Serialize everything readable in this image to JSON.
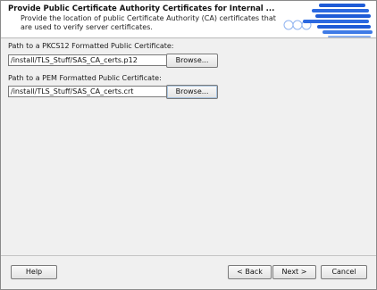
{
  "header": {
    "title": "Provide Public Certificate Authority Certificates for Internal ...",
    "description": "Provide the location of public Certificate Authority (CA) certificates that are used to verify server certificates."
  },
  "pkcs12": {
    "label": "Path to a PKCS12 Formatted Public Certificate:",
    "value": "/install/TLS_Stuff/SAS_CA_certs.p12",
    "browse_label": "Browse..."
  },
  "pem": {
    "label": "Path to a PEM Formatted Public Certificate:",
    "value": "/install/TLS_Stuff/SAS_CA_certs.crt",
    "browse_label": "Browse..."
  },
  "footer": {
    "help_label": "Help",
    "back_label": "< Back",
    "next_label": "Next >",
    "cancel_label": "Cancel"
  },
  "colors": {
    "brand_blue": "#1f5bd6",
    "light_blue": "#8fb3f0"
  }
}
